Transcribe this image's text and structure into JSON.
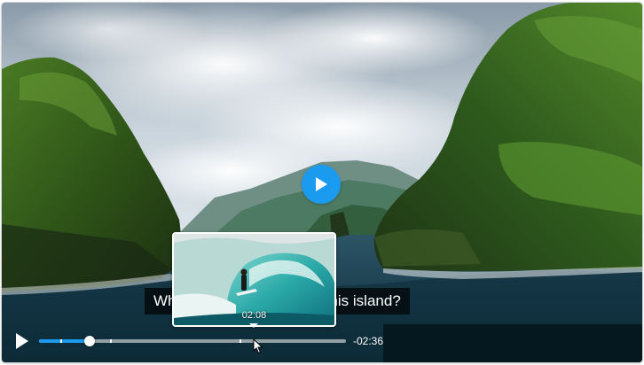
{
  "player": {
    "subtitle": "Who wants to be born on this island?",
    "preview_time": "02:08",
    "time_remaining": "-02:36",
    "progress_played_fraction": 0.165,
    "hover_fraction": 0.65,
    "accent_color": "#1a9bf0"
  },
  "icons": {
    "big_play": "play-circle-icon",
    "control_play": "play-icon",
    "cursor": "mouse-pointer-icon"
  }
}
